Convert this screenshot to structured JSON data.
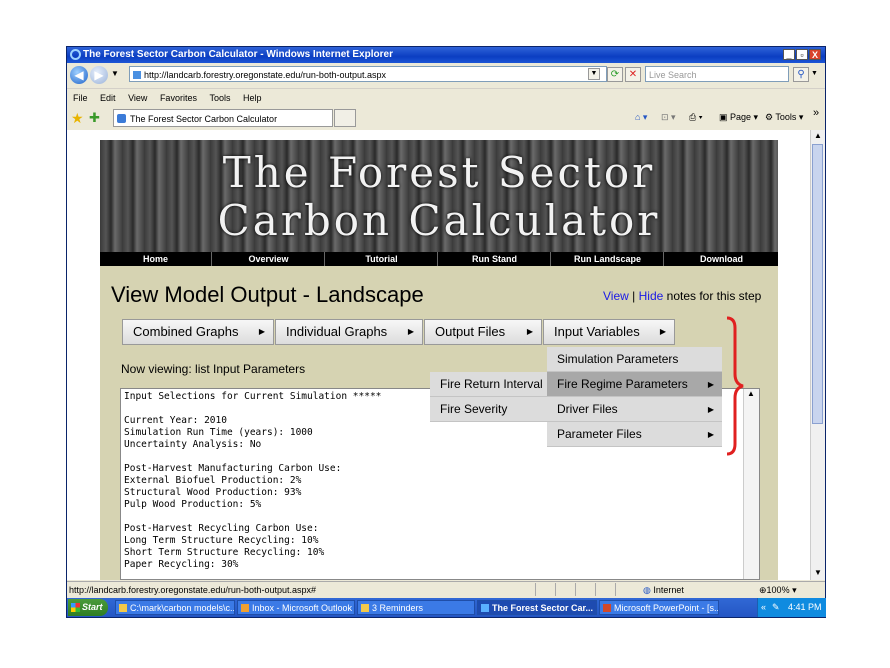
{
  "window": {
    "title": "The Forest Sector Carbon Calculator - Windows Internet Explorer",
    "controls": [
      "_",
      "▫",
      "X"
    ]
  },
  "address": {
    "url": "http://landcarb.forestry.oregonstate.edu/run-both-output.aspx",
    "search_placeholder": "Live Search"
  },
  "menubar": [
    "File",
    "Edit",
    "View",
    "Favorites",
    "Tools",
    "Help"
  ],
  "tab": {
    "label": "The Forest Sector Carbon Calculator"
  },
  "toolbar_right": {
    "page": "Page",
    "tools": "Tools"
  },
  "site": {
    "banner_line1": "The Forest Sector",
    "banner_line2": "Carbon Calculator",
    "nav": [
      "Home",
      "Overview",
      "Tutorial",
      "Run Stand",
      "Run Landscape",
      "Download"
    ],
    "page_title": "View Model Output - Landscape",
    "notes": {
      "view": "View",
      "sep": "|",
      "hide": "Hide",
      "suffix": "notes for this step"
    },
    "main_menu": [
      "Combined Graphs",
      "Individual Graphs",
      "Output Files",
      "Input Variables"
    ],
    "viewing": "Now viewing: list Input Parameters",
    "input_variables_menu": [
      "Simulation Parameters",
      "Fire Regime Parameters",
      "Driver Files",
      "Parameter Files"
    ],
    "fire_submenu": [
      "Fire Return Interval",
      "Fire Severity"
    ],
    "text_lines": [
      "Input Selections for Current Simulation *****",
      "",
      "Current Year: 2010",
      "Simulation Run Time (years): 1000",
      "Uncertainty Analysis: No",
      "",
      "Post-Harvest Manufacturing Carbon Use:",
      "External Biofuel Production: 2%",
      "Structural Wood Production: 93%",
      "Pulp Wood Production: 5%",
      "",
      "Post-Harvest Recycling Carbon Use:",
      "Long Term Structure Recycling: 10%",
      "Short Term Structure Recycling: 10%",
      "Paper Recycling: 30%"
    ]
  },
  "status": {
    "url": "http://landcarb.forestry.oregonstate.edu/run-both-output.aspx#",
    "zone": "Internet",
    "zoom": "100%"
  },
  "taskbar": {
    "start": "Start",
    "tasks": [
      "C:\\mark\\carbon models\\c...",
      "Inbox - Microsoft Outlook",
      "3 Reminders",
      "The Forest Sector Car...",
      "Microsoft PowerPoint - [s..."
    ],
    "clock": "4:41 PM"
  }
}
